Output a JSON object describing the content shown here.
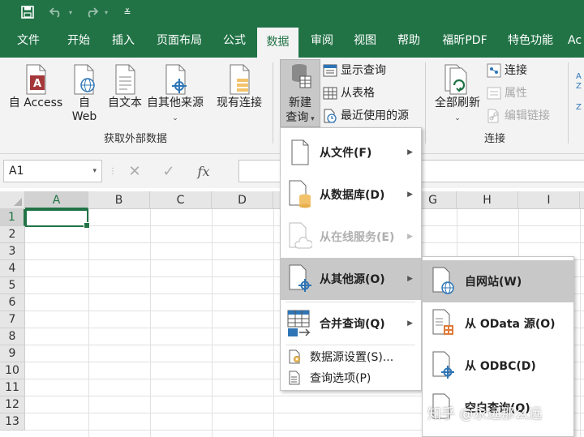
{
  "tabs": [
    "文件",
    "开始",
    "插入",
    "页面布局",
    "公式",
    "数据",
    "审阅",
    "视图",
    "帮助",
    "福昕PDF",
    "特色功能",
    "Ac"
  ],
  "active_tab": "数据",
  "ribbon": {
    "get_data": {
      "from_access": "自 Access",
      "from_web_line1": "自",
      "from_web_line2": "Web",
      "from_text": "自文本",
      "from_other": "自其他来源",
      "existing_connections": "现有连接",
      "group_label": "获取外部数据"
    },
    "new_query": {
      "line1": "新建",
      "line2": "查询"
    },
    "show_queries": "显示查询",
    "from_table": "从表格",
    "recent_sources": "最近使用的源",
    "refresh_all": "全部刷新",
    "connections": "连接",
    "properties": "属性",
    "edit_links": "编辑链接",
    "connections_group_label": "连接"
  },
  "formula_bar": {
    "name_box": "A1",
    "fx": "fx"
  },
  "columns": [
    "A",
    "B",
    "C",
    "D",
    "G",
    "H",
    "I"
  ],
  "rows": [
    "1",
    "2",
    "3",
    "4",
    "5",
    "6",
    "7",
    "8",
    "9",
    "10",
    "11",
    "12",
    "13"
  ],
  "menu": {
    "from_file": "从文件(F)",
    "from_database": "从数据库(D)",
    "from_online": "从在线服务(E)",
    "from_other": "从其他源(O)",
    "combine": "合并查询(Q)",
    "source_settings": "数据源设置(S)...",
    "query_options": "查询选项(P)"
  },
  "submenu": {
    "from_web": "自网站(W)",
    "from_odata": "从 OData 源(O)",
    "from_odbc": "从 ODBC(D)",
    "blank_query": "空白查询(Q)"
  },
  "watermark": "知乎 @永远那么远",
  "colors": {
    "excel_green": "#217346",
    "ribbon_bg": "#f3f3f3",
    "highlight": "#c8c8c8"
  }
}
